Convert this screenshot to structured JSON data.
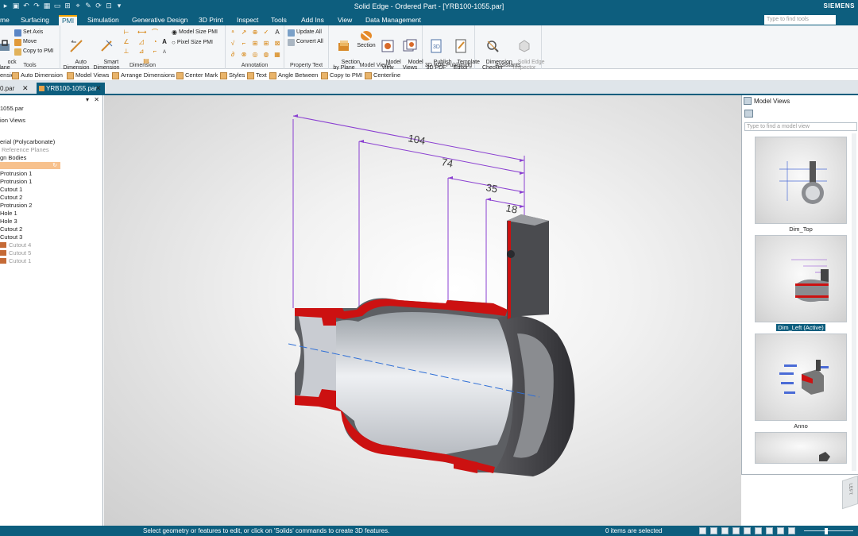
{
  "titlebar": {
    "title": "Solid Edge - Ordered Part - [YRB100-1055.par]",
    "brand": "SIEMENS",
    "qat_icons": [
      "save-icon",
      "undo-icon",
      "redo-icon",
      "customize-icon"
    ]
  },
  "ribbon_tabs": {
    "home": "me",
    "surfacing": "Surfacing",
    "pmi": "PMI",
    "simulation": "Simulation",
    "generative": "Generative Design",
    "print3d": "3D Print",
    "inspect": "Inspect",
    "tools": "Tools",
    "addins": "Add Ins",
    "view": "View",
    "datamgmt": "Data Management",
    "search_placeholder": "Type to find tools"
  },
  "ribbon": {
    "tools_group": {
      "lock_plane": "ock\nlane",
      "set_axis": "Set Axis",
      "move": "Move",
      "copy_to_pmi": "Copy to PMI",
      "label": "Tools"
    },
    "dimension_group": {
      "auto_dimension": "Auto\nDimension",
      "smart_dimension": "Smart\nDimension",
      "model_size_pmi": "Model Size PMI",
      "pixel_size_pmi": "Pixel Size PMI",
      "label": "Dimension"
    },
    "annotation_group": {
      "label": "Annotation"
    },
    "property_text_group": {
      "update_all": "Update All",
      "convert_all": "Convert All",
      "label": "Property Text"
    },
    "model_views_group": {
      "section_by_plane": "Section\nby Plane",
      "section": "Section",
      "model_view": "Model\nView",
      "model_views": "Model\nViews",
      "label": "Model Views"
    },
    "publish_group": {
      "publish_3d_pdf": "Publish\n3D PDF",
      "template_editor": "Template\nEditor",
      "label": "3D PDF Publishing"
    },
    "assistants_group": {
      "dimension_checker": "Dimension\nChecker",
      "solid_edge_inspector": "Solid Edge\nInspector",
      "label": "Assistants"
    }
  },
  "command_bar": {
    "dimension": "ension",
    "auto_dimension": "Auto Dimension",
    "model_views": "Model Views",
    "arrange_dimensions": "Arrange Dimensions",
    "center_mark": "Center Mark",
    "styles": "Styles",
    "text": "Text",
    "angle_between": "Angle Between",
    "copy_to_pmi": "Copy to PMI",
    "centerline": "Centerline"
  },
  "doc_tabs": {
    "first": "0.par",
    "second": "YRB100-1055.par"
  },
  "pathfinder": {
    "items": [
      {
        "label": "1055.par",
        "style": "normal"
      },
      {
        "label": "ion Views",
        "style": "normal"
      },
      {
        "label": "erial (Polycarbonate)",
        "style": "normal"
      },
      {
        "label": "Reference Planes",
        "style": "grey"
      },
      {
        "label": "gn Bodies",
        "style": "normal"
      },
      {
        "label": "",
        "style": "selected"
      },
      {
        "label": "Protrusion 1",
        "style": "normal"
      },
      {
        "label": "Protrusion 1",
        "style": "normal"
      },
      {
        "label": "Cutout 1",
        "style": "normal"
      },
      {
        "label": "Cutout 2",
        "style": "normal"
      },
      {
        "label": "Protrusion 2",
        "style": "normal"
      },
      {
        "label": "Hole 1",
        "style": "normal"
      },
      {
        "label": "Hole 3",
        "style": "normal"
      },
      {
        "label": "Cutout 2",
        "style": "normal"
      },
      {
        "label": "Cutout 3",
        "style": "normal"
      },
      {
        "label": "Cutout 4",
        "style": "grey-body"
      },
      {
        "label": "Cutout 5",
        "style": "grey-body"
      },
      {
        "label": "Cutout 1",
        "style": "grey-body"
      }
    ]
  },
  "viewport": {
    "dimensions": [
      "104",
      "74",
      "35",
      "18"
    ],
    "part_color": "#cc1111",
    "dimension_color": "#8a3fd1",
    "axis_color": "#2f6fd6"
  },
  "model_views_pane": {
    "title": "Model Views",
    "find_placeholder": "Type to find a model view",
    "views": [
      {
        "label": "Dim_Top",
        "active": false
      },
      {
        "label": "Dim_Left (Active)",
        "active": true
      },
      {
        "label": "Anno",
        "active": false
      },
      {
        "label": "",
        "active": false
      }
    ]
  },
  "viewcube": {
    "face": "LEFT"
  },
  "statusbar": {
    "message": "Select geometry or features to edit, or click on 'Solids' commands to create 3D features.",
    "selection": "0 items are selected"
  }
}
